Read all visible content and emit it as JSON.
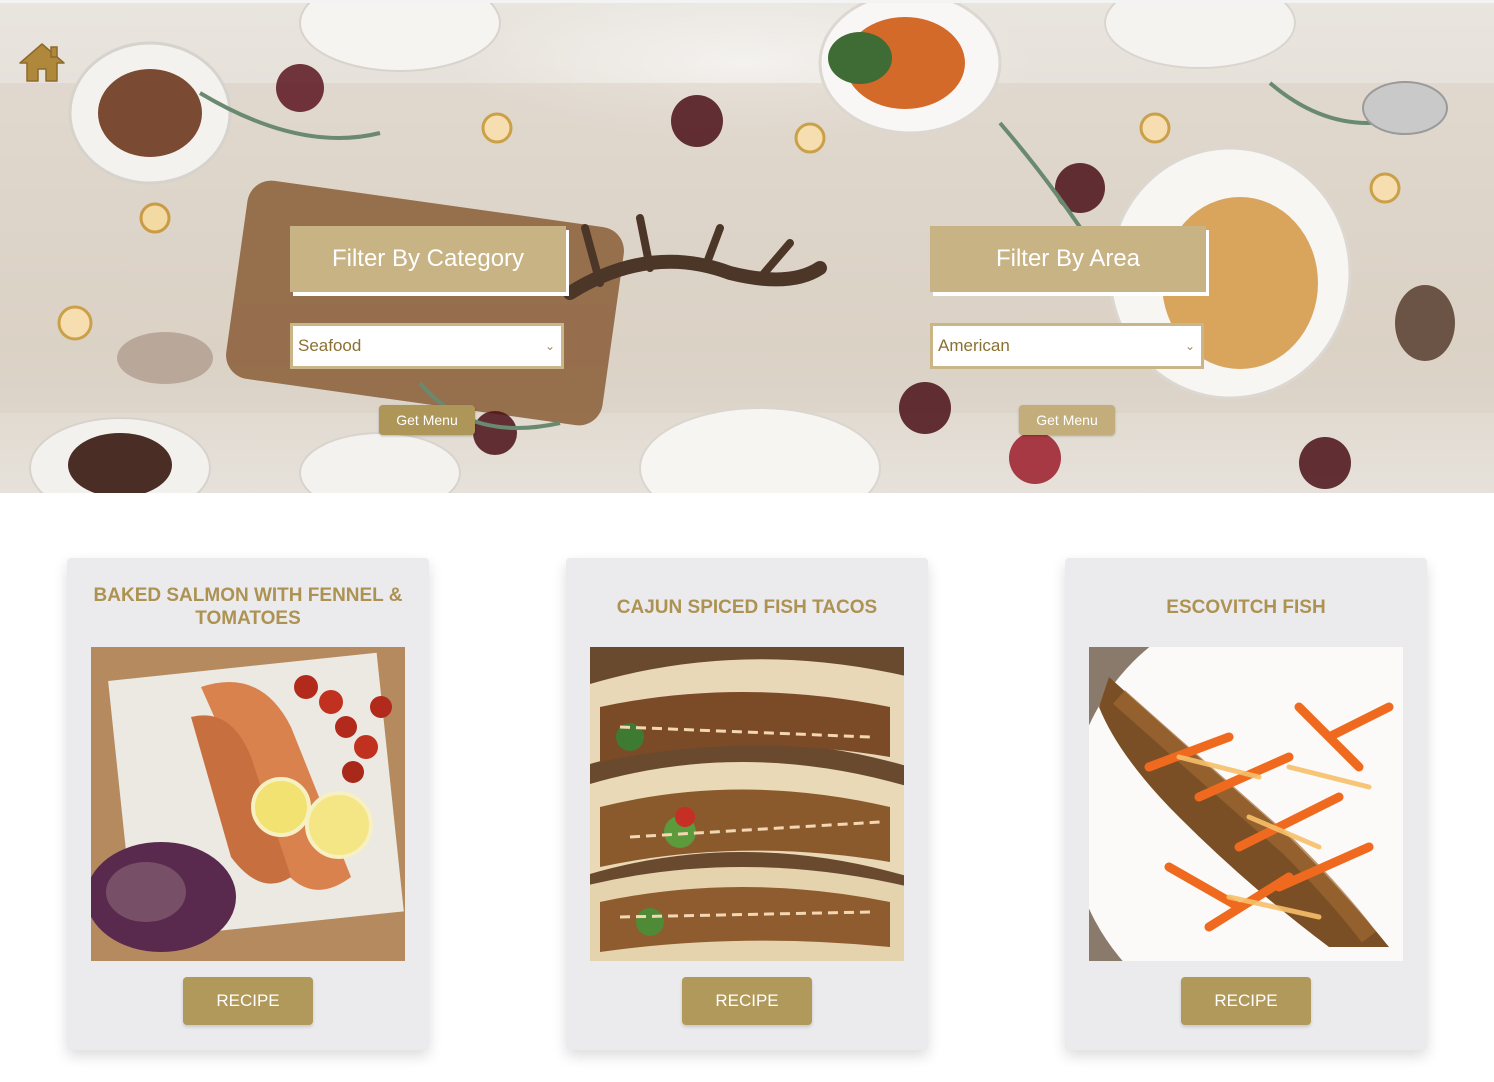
{
  "home": {
    "icon": "home-icon"
  },
  "filters": {
    "category": {
      "title": "Filter By Category",
      "selected": "Seafood",
      "button_label": "Get Menu"
    },
    "area": {
      "title": "Filter By Area",
      "selected": "American",
      "button_label": "Get Menu"
    }
  },
  "meals": [
    {
      "title": "Baked Salmon with Fennel & Tomatoes",
      "button_label": "RECIPE"
    },
    {
      "title": "Cajun spiced fish tacos",
      "button_label": "RECIPE"
    },
    {
      "title": "Escovitch Fish",
      "button_label": "RECIPE"
    }
  ],
  "colors": {
    "accent": "#c7b384",
    "button": "#b0995a",
    "title_text": "#ad9252",
    "card_bg": "#ebebee"
  }
}
